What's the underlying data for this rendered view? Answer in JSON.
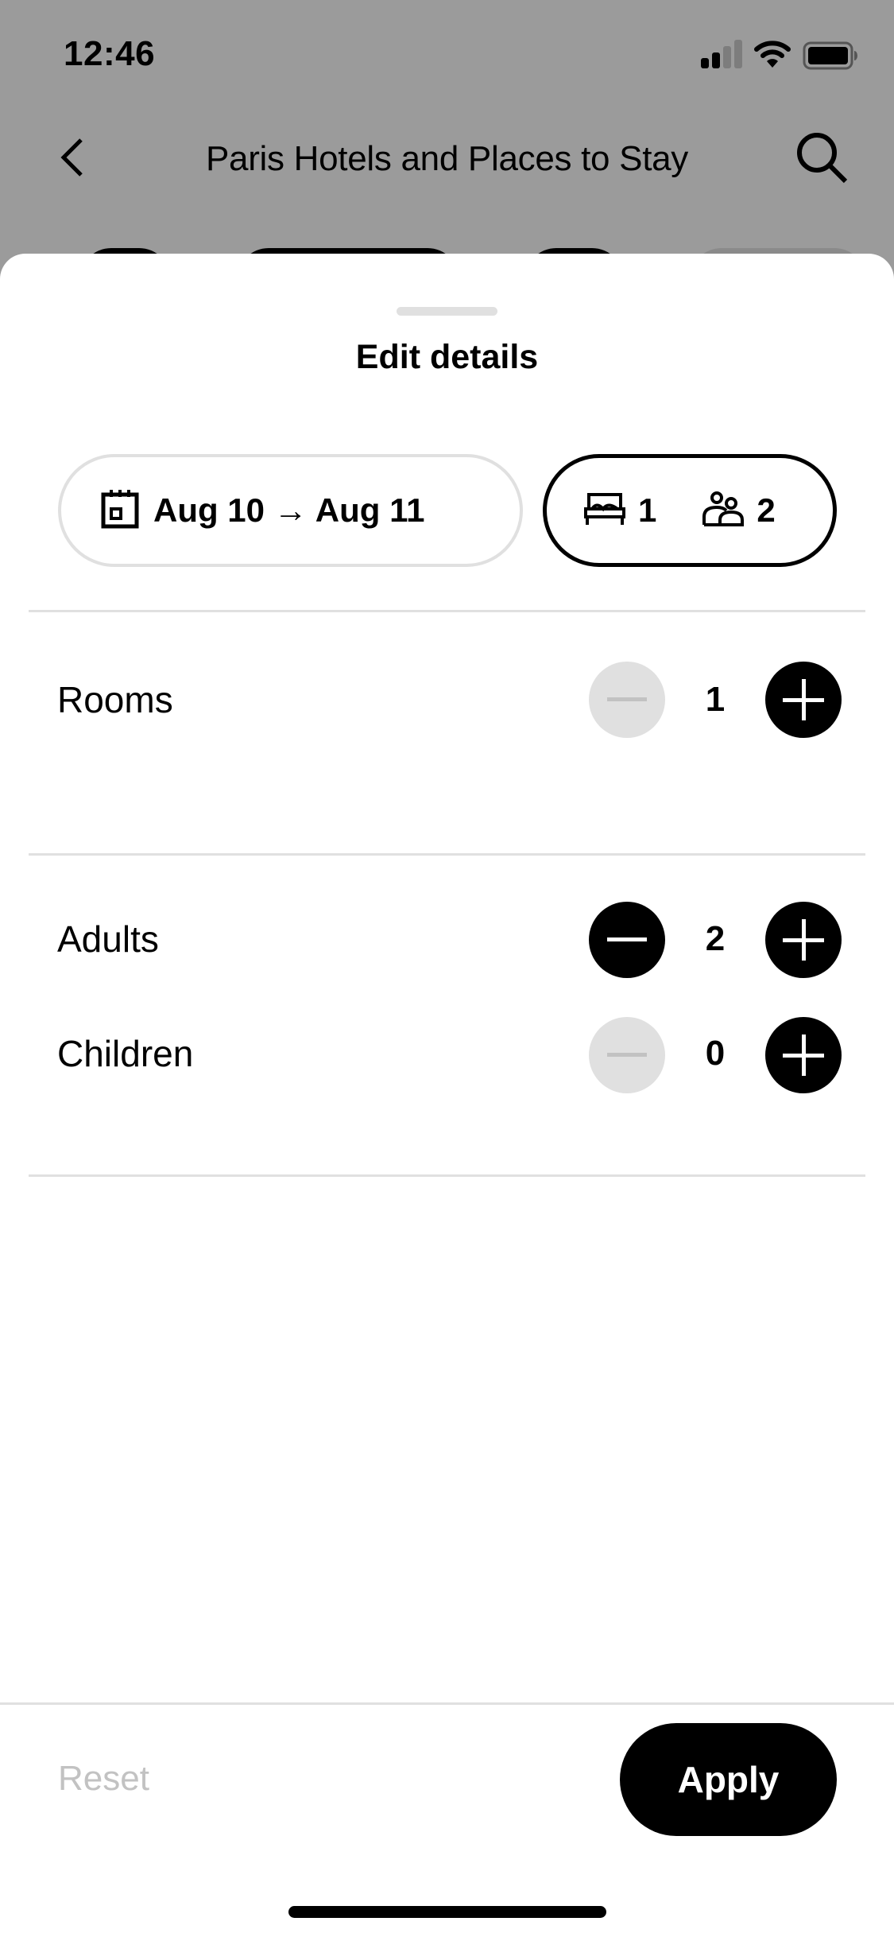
{
  "status_bar": {
    "time": "12:46",
    "signal_bars_filled": 2,
    "signal_bars_total": 4,
    "wifi": "wifi-icon",
    "battery": "battery-full-icon"
  },
  "header": {
    "title": "Paris Hotels and Places to Stay",
    "back_icon": "chevron-left-icon",
    "search_icon": "search-icon"
  },
  "sheet": {
    "title": "Edit details",
    "dates": {
      "icon": "calendar-icon",
      "label": "Aug 10 → Aug 11"
    },
    "guests_summary": {
      "rooms_icon": "bed-icon",
      "rooms": "1",
      "guests_icon": "people-icon",
      "guests": "2"
    },
    "steppers": [
      {
        "label": "Rooms",
        "value": "1",
        "decrement_enabled": false,
        "increment_enabled": true
      },
      {
        "label": "Adults",
        "value": "2",
        "decrement_enabled": true,
        "increment_enabled": true
      },
      {
        "label": "Children",
        "value": "0",
        "decrement_enabled": false,
        "increment_enabled": true
      }
    ]
  },
  "footer": {
    "reset_label": "Reset",
    "apply_label": "Apply"
  },
  "colors": {
    "overlay": "#9b9b9b",
    "accent": "#000000",
    "disabled": "#e0e0e0",
    "disabled_text": "#c2c2c2",
    "divider": "#e0e0e0"
  }
}
